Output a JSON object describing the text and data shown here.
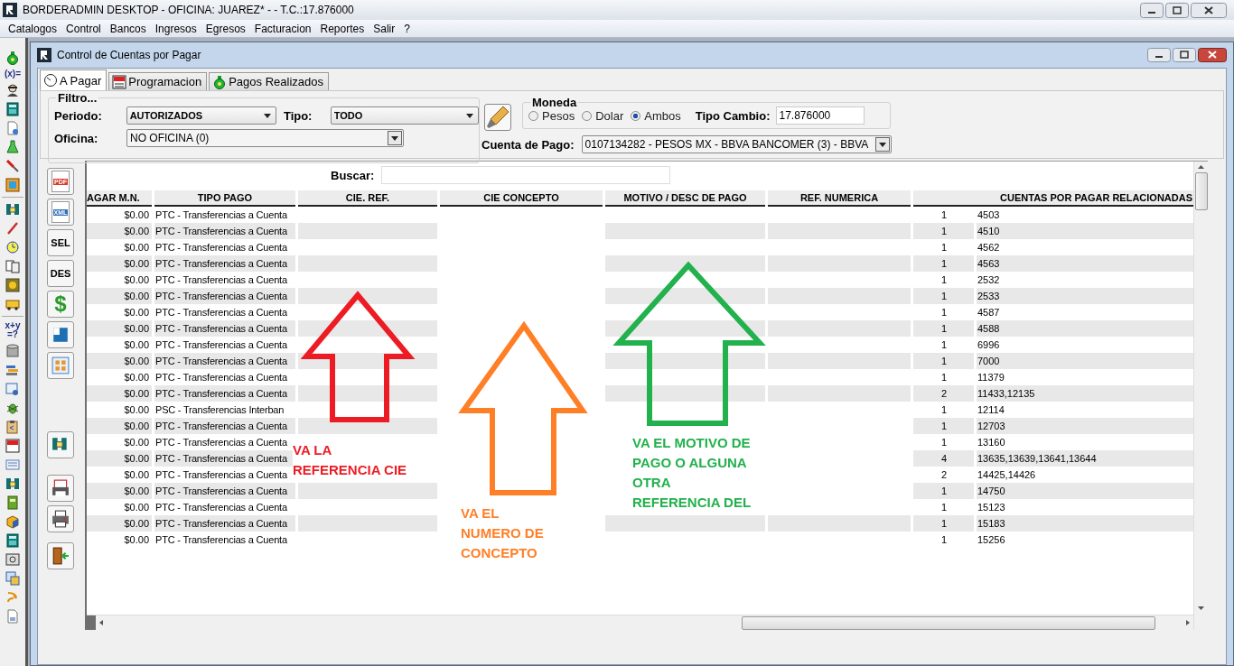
{
  "window": {
    "title": "BORDERADMIN DESKTOP - OFICINA: JUAREZ* -  - T.C.:17.876000"
  },
  "menu": [
    "Catalogos",
    "Control",
    "Bancos",
    "Ingresos",
    "Egresos",
    "Facturacion",
    "Reportes",
    "Salir",
    "?"
  ],
  "left_toolbar": {
    "texts": [
      "(x)=",
      "x+y\n=?"
    ]
  },
  "child_window": {
    "title": "Control de Cuentas por Pagar"
  },
  "tabs": [
    {
      "label": "A Pagar",
      "selected": true
    },
    {
      "label": "Programacion",
      "selected": false
    },
    {
      "label": "Pagos Realizados",
      "selected": false
    }
  ],
  "filter": {
    "title": "Filtro...",
    "periodo": {
      "label": "Periodo:",
      "value": "AUTORIZADOS"
    },
    "tipo": {
      "label": "Tipo:",
      "value": "TODO"
    },
    "oficina": {
      "label": "Oficina:",
      "value": "NO OFICINA (0)"
    }
  },
  "moneda": {
    "title": "Moneda",
    "options": [
      {
        "label": "Pesos",
        "selected": false
      },
      {
        "label": "Dolar",
        "selected": false
      },
      {
        "label": "Ambos",
        "selected": true
      }
    ],
    "tipo_cambio": {
      "label": "Tipo Cambio:",
      "value": "17.876000"
    }
  },
  "cuenta_pago": {
    "label": "Cuenta de Pago:",
    "value": "0107134282 - PESOS MX - BBVA BANCOMER (3) - BBVA"
  },
  "side_buttons": [
    {
      "kind": "pdf",
      "label": "PDF"
    },
    {
      "kind": "xml",
      "label": "XML"
    },
    {
      "kind": "text",
      "label": "SEL"
    },
    {
      "kind": "text",
      "label": "DES"
    },
    {
      "kind": "dollar",
      "label": "$"
    },
    {
      "kind": "layout"
    },
    {
      "kind": "grid"
    },
    {
      "kind": "binder"
    },
    {
      "kind": "report"
    },
    {
      "kind": "printer"
    },
    {
      "kind": "exit"
    }
  ],
  "search": {
    "label": "Buscar:"
  },
  "table": {
    "columns": [
      "AGAR M.N.",
      "TIPO PAGO",
      "CIE. REF.",
      "CIE CONCEPTO",
      "MOTIVO / DESC DE PAGO",
      "REF. NUMERICA",
      "CUENTAS POR PAGAR RELACIONADAS"
    ],
    "rows": [
      {
        "amount": "$0.00",
        "tipo_pago": "PTC - Transferencias a Cuenta",
        "count": "1",
        "cuentas": "4503"
      },
      {
        "amount": "$0.00",
        "tipo_pago": "PTC - Transferencias a Cuenta",
        "count": "1",
        "cuentas": "4510"
      },
      {
        "amount": "$0.00",
        "tipo_pago": "PTC - Transferencias a Cuenta",
        "count": "1",
        "cuentas": "4562"
      },
      {
        "amount": "$0.00",
        "tipo_pago": "PTC - Transferencias a Cuenta",
        "count": "1",
        "cuentas": "4563"
      },
      {
        "amount": "$0.00",
        "tipo_pago": "PTC - Transferencias a Cuenta",
        "count": "1",
        "cuentas": "2532"
      },
      {
        "amount": "$0.00",
        "tipo_pago": "PTC - Transferencias a Cuenta",
        "count": "1",
        "cuentas": "2533"
      },
      {
        "amount": "$0.00",
        "tipo_pago": "PTC - Transferencias a Cuenta",
        "count": "1",
        "cuentas": "4587"
      },
      {
        "amount": "$0.00",
        "tipo_pago": "PTC - Transferencias a Cuenta",
        "count": "1",
        "cuentas": "4588"
      },
      {
        "amount": "$0.00",
        "tipo_pago": "PTC - Transferencias a Cuenta",
        "count": "1",
        "cuentas": "6996"
      },
      {
        "amount": "$0.00",
        "tipo_pago": "PTC - Transferencias a Cuenta",
        "count": "1",
        "cuentas": "7000"
      },
      {
        "amount": "$0.00",
        "tipo_pago": "PTC - Transferencias a Cuenta",
        "count": "1",
        "cuentas": "11379"
      },
      {
        "amount": "$0.00",
        "tipo_pago": "PTC - Transferencias a Cuenta",
        "count": "2",
        "cuentas": "11433,12135"
      },
      {
        "amount": "$0.00",
        "tipo_pago": "PSC - Transferencias Interban",
        "count": "1",
        "cuentas": "12114"
      },
      {
        "amount": "$0.00",
        "tipo_pago": "PTC - Transferencias a Cuenta",
        "count": "1",
        "cuentas": "12703"
      },
      {
        "amount": "$0.00",
        "tipo_pago": "PTC - Transferencias a Cuenta",
        "count": "1",
        "cuentas": "13160"
      },
      {
        "amount": "$0.00",
        "tipo_pago": "PTC - Transferencias a Cuenta",
        "count": "4",
        "cuentas": "13635,13639,13641,13644"
      },
      {
        "amount": "$0.00",
        "tipo_pago": "PTC - Transferencias a Cuenta",
        "count": "2",
        "cuentas": "14425,14426"
      },
      {
        "amount": "$0.00",
        "tipo_pago": "PTC - Transferencias a Cuenta",
        "count": "1",
        "cuentas": "14750"
      },
      {
        "amount": "$0.00",
        "tipo_pago": "PTC - Transferencias a Cuenta",
        "count": "1",
        "cuentas": "15123"
      },
      {
        "amount": "$0.00",
        "tipo_pago": "PTC - Transferencias a Cuenta",
        "count": "1",
        "cuentas": "15183"
      },
      {
        "amount": "$0.00",
        "tipo_pago": "PTC - Transferencias a Cuenta",
        "count": "1",
        "cuentas": "15256"
      }
    ]
  },
  "annotations": [
    {
      "color": "#ed1c24",
      "text": "VA LA\nREFERENCIA CIE"
    },
    {
      "color": "#ff7f27",
      "text": "VA EL\nNUMERO DE\nCONCEPTO"
    },
    {
      "color": "#22b14c",
      "text": "VA EL MOTIVO DE\nPAGO O ALGUNA\nOTRA\nREFERENCIA DEL"
    }
  ]
}
